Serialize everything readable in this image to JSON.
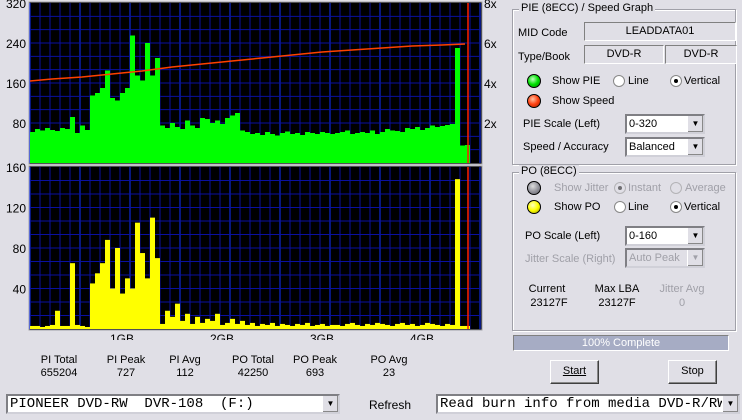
{
  "chart_data": [
    {
      "type": "bar",
      "title": "",
      "series": [
        {
          "name": "PIE",
          "color": "#00ff00",
          "x_start": 0.08,
          "x_step": 0.05,
          "values": [
            62,
            68,
            65,
            70,
            66,
            64,
            70,
            68,
            92,
            60,
            75,
            66,
            135,
            140,
            150,
            185,
            130,
            125,
            140,
            150,
            255,
            175,
            165,
            240,
            175,
            210,
            75,
            70,
            80,
            72,
            68,
            85,
            75,
            70,
            90,
            88,
            80,
            85,
            78,
            90,
            95,
            100,
            65,
            62,
            58,
            60,
            56,
            62,
            58,
            55,
            60,
            63,
            58,
            60,
            56,
            62,
            60,
            58,
            62,
            60,
            58,
            60,
            62,
            65,
            58,
            60,
            62,
            60,
            65,
            58,
            62,
            68,
            65,
            64,
            62,
            70,
            68,
            72,
            66,
            70,
            75,
            72,
            74,
            76,
            78,
            230,
            35,
            36
          ]
        },
        {
          "name": "Speed",
          "type": "line",
          "color": "#ff4000",
          "points": [
            [
              0.08,
              4.1
            ],
            [
              0.3,
              4.2
            ],
            [
              0.6,
              4.3
            ],
            [
              0.9,
              4.45
            ],
            [
              1.2,
              4.6
            ],
            [
              1.5,
              4.8
            ],
            [
              1.8,
              4.95
            ],
            [
              2.1,
              5.1
            ],
            [
              2.4,
              5.25
            ],
            [
              2.7,
              5.4
            ],
            [
              3.0,
              5.55
            ],
            [
              3.3,
              5.65
            ],
            [
              3.6,
              5.75
            ],
            [
              3.9,
              5.85
            ],
            [
              4.2,
              5.9
            ],
            [
              4.43,
              5.95
            ]
          ]
        }
      ],
      "ylim": [
        0,
        320
      ],
      "y2lim": [
        0,
        8
      ],
      "yticks": [
        "320",
        "240",
        "160",
        "80"
      ],
      "yticks_values": [
        320,
        240,
        160,
        80
      ],
      "y2ticks": [
        "8x",
        "6x",
        "4x",
        "2x"
      ],
      "y2ticks_values": [
        8,
        6,
        4,
        2
      ],
      "position_marker": 4.46,
      "grid": true
    },
    {
      "type": "bar",
      "series": [
        {
          "name": "PO",
          "color": "#ffff00",
          "x_start": 0.08,
          "x_step": 0.05,
          "values": [
            3,
            3,
            2,
            3,
            4,
            18,
            3,
            3,
            65,
            4,
            3,
            2,
            45,
            55,
            65,
            88,
            40,
            80,
            35,
            50,
            40,
            105,
            75,
            50,
            110,
            70,
            5,
            18,
            12,
            25,
            8,
            15,
            5,
            12,
            6,
            10,
            8,
            15,
            4,
            6,
            10,
            5,
            8,
            4,
            6,
            3,
            5,
            4,
            6,
            3,
            5,
            4,
            3,
            5,
            4,
            6,
            3,
            4,
            5,
            3,
            4,
            4,
            3,
            5,
            6,
            4,
            3,
            5,
            4,
            6,
            5,
            4,
            3,
            5,
            6,
            4,
            5,
            3,
            4,
            6,
            5,
            4,
            3,
            5,
            4,
            148,
            3,
            3
          ]
        }
      ],
      "ylim": [
        0,
        160
      ],
      "yticks": [
        "160",
        "120",
        "80",
        "40"
      ],
      "yticks_values": [
        160,
        120,
        80,
        40
      ],
      "xticks": [
        "1GB",
        "2GB",
        "3GB",
        "4GB"
      ],
      "xticks_values": [
        1,
        2,
        3,
        4
      ],
      "position_marker": 4.46,
      "grid": true
    }
  ],
  "stats": [
    {
      "label": "PI Total",
      "value": "655204"
    },
    {
      "label": "PI Peak",
      "value": "727"
    },
    {
      "label": "PI Avg",
      "value": "112"
    },
    {
      "label": "PO Total",
      "value": "42250"
    },
    {
      "label": "PO Peak",
      "value": "693"
    },
    {
      "label": "PO Avg",
      "value": "23"
    }
  ],
  "pie_group": {
    "title": "PIE (8ECC) / Speed Graph",
    "mid_label": "MID Code",
    "mid_value": "LEADDATA01",
    "type_label": "Type/Book",
    "type_value": "DVD-R",
    "book_value": "DVD-R",
    "show_pie": "Show PIE",
    "show_speed": "Show Speed",
    "line": "Line",
    "vertical": "Vertical",
    "scale_label": "PIE Scale (Left)",
    "scale_value": "0-320",
    "accuracy_label": "Speed / Accuracy",
    "accuracy_value": "Balanced",
    "pie_color": "#00e000",
    "speed_color": "#ff4010"
  },
  "po_group": {
    "title": "PO (8ECC)",
    "show_jitter": "Show Jitter",
    "instant": "Instant",
    "average": "Average",
    "show_po": "Show PO",
    "line": "Line",
    "vertical": "Vertical",
    "scale_label": "PO Scale (Left)",
    "scale_value": "0-160",
    "jitter_scale_label": "Jitter Scale (Right)",
    "jitter_scale_value": "Auto Peak",
    "current_label": "Current",
    "current_value": "23127F",
    "maxlba_label": "Max LBA",
    "maxlba_value": "23127F",
    "jitter_avg_label": "Jitter Avg",
    "jitter_avg_value": "0",
    "po_color": "#ffff00"
  },
  "progress": {
    "text": "100% Complete",
    "percent": 100
  },
  "buttons": {
    "start": "Start",
    "stop": "Stop",
    "refresh": "Refresh"
  },
  "drive": {
    "value": "PIONEER DVD-RW  DVR-108  (F:)"
  },
  "mode": {
    "value": "Read burn info from media DVD-R/RW"
  }
}
